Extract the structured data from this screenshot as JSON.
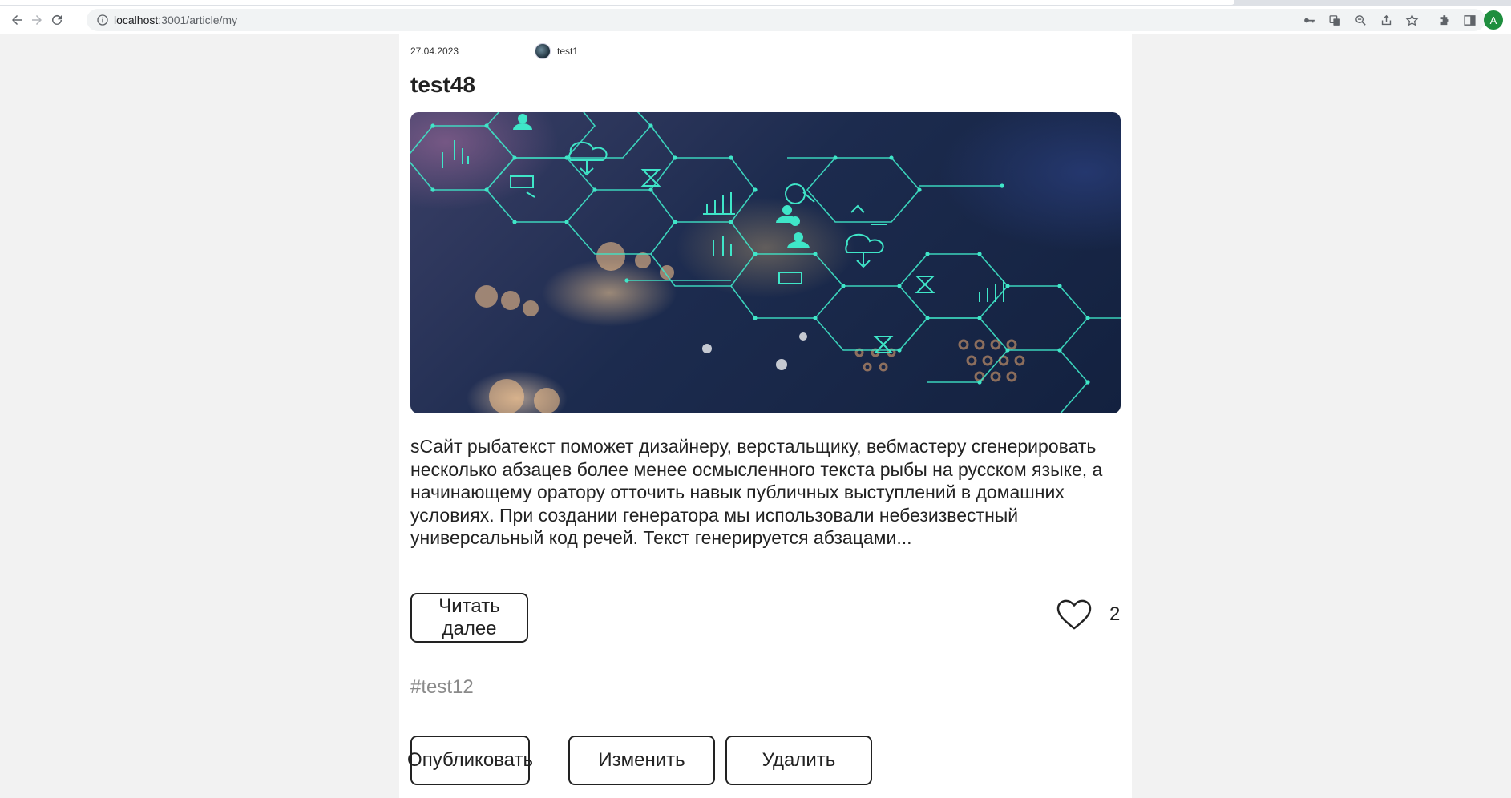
{
  "browser": {
    "url_host": "localhost",
    "url_rest": ":3001/article/my",
    "profile_initial": "A"
  },
  "article": {
    "date": "27.04.2023",
    "author": "test1",
    "title": "test48",
    "excerpt": "sСайт рыбатекст поможет дизайнеру, верстальщику, вебмастеру сгенерировать несколько абзацев более менее осмысленного текста рыбы на русском языке, а начинающему оратору отточить навык публичных выступлений в домашних условиях. При создании генератора мы использовали небезизвестный универсальный код речей. Текст генерируется абзацами...",
    "read_more_label": "Читать далее",
    "likes": "2",
    "tag": "#test12"
  },
  "actions": {
    "publish_label": "Опубликовать",
    "edit_label": "Изменить",
    "delete_label": "Удалить"
  },
  "colors": {
    "accent_text": "#222222",
    "tag": "#8a8a8a",
    "hero_lines": "#3fe6c8"
  }
}
